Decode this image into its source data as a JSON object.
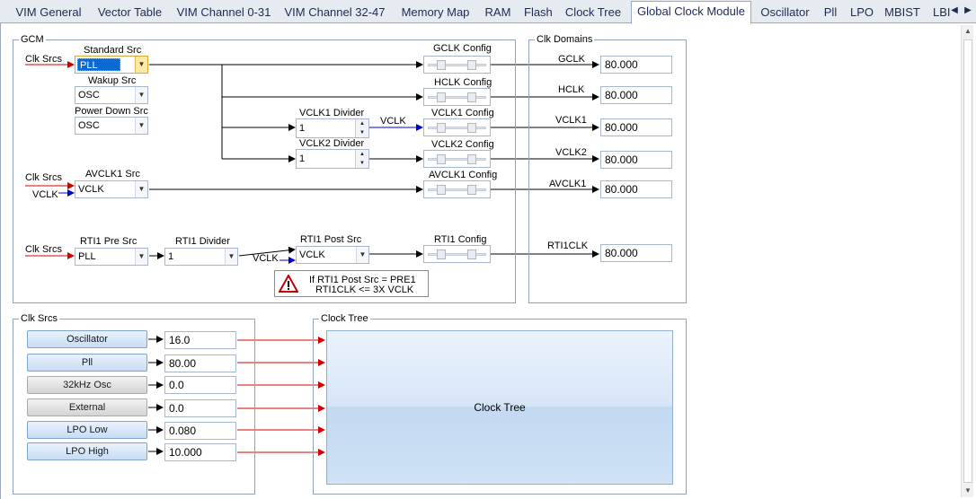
{
  "tabs": [
    {
      "label": "VIM General",
      "active": false
    },
    {
      "label": "Vector Table",
      "active": false
    },
    {
      "label": "VIM Channel 0-31",
      "active": false
    },
    {
      "label": "VIM Channel 32-47",
      "active": false
    },
    {
      "label": "Memory Map",
      "active": false
    },
    {
      "label": "RAM",
      "active": false
    },
    {
      "label": "Flash",
      "active": false
    },
    {
      "label": "Clock Tree",
      "active": false
    },
    {
      "label": "Global Clock Module",
      "active": true
    },
    {
      "label": "Oscillator",
      "active": false
    },
    {
      "label": "Pll",
      "active": false
    },
    {
      "label": "LPO",
      "active": false
    },
    {
      "label": "MBIST",
      "active": false
    },
    {
      "label": "LBI",
      "active": false
    }
  ],
  "gcm": {
    "title": "GCM",
    "clk_srcs_label": "Clk Srcs",
    "standard_src": {
      "label": "Standard Src",
      "value": "PLL"
    },
    "wakeup_src": {
      "label": "Wakup Src",
      "value": "OSC"
    },
    "power_down_src": {
      "label": "Power Down Src",
      "value": "OSC"
    },
    "vclk1_divider": {
      "label": "VCLK1 Divider",
      "value": "1"
    },
    "vclk2_divider": {
      "label": "VCLK2 Divider",
      "value": "1"
    },
    "vclk_signal": "VCLK",
    "gclk_config": "GCLK Config",
    "hclk_config": "HCLK Config",
    "vclk1_config": "VCLK1 Config",
    "vclk2_config": "VCLK2 Config",
    "avclk1_clk_srcs_label": "Clk Srcs",
    "avclk1_vclk_label": "VCLK",
    "avclk1_src": {
      "label": "AVCLK1 Src",
      "value": "VCLK"
    },
    "avclk1_config": "AVCLK1 Config",
    "rti_clk_srcs_label": "Clk Srcs",
    "rti1_pre_src": {
      "label": "RTI1 Pre Src",
      "value": "PLL"
    },
    "rti1_divider": {
      "label": "RTI1 Divider",
      "value": "1"
    },
    "rti1_post_src": {
      "label": "RTI1 Post Src",
      "value": "VCLK"
    },
    "rti_vclk_label": "VCLK",
    "rti1_config": "RTI1 Config",
    "warning_line1": "If RTI1 Post Src = PRE1",
    "warning_line2": "RTI1CLK <= 3X VCLK"
  },
  "clk_domains": {
    "title": "Clk Domains",
    "items": [
      {
        "label": "GCLK",
        "value": "80.000"
      },
      {
        "label": "HCLK",
        "value": "80.000"
      },
      {
        "label": "VCLK1",
        "value": "80.000"
      },
      {
        "label": "VCLK2",
        "value": "80.000"
      },
      {
        "label": "AVCLK1",
        "value": "80.000"
      },
      {
        "label": "RTI1CLK",
        "value": "80.000"
      }
    ]
  },
  "clk_srcs": {
    "title": "Clk Srcs",
    "items": [
      {
        "label": "Oscillator",
        "value": "16.0",
        "enabled": true
      },
      {
        "label": "Pll",
        "value": "80.00",
        "enabled": true
      },
      {
        "label": "32kHz Osc",
        "value": "0.0",
        "enabled": false
      },
      {
        "label": "External",
        "value": "0.0",
        "enabled": false
      },
      {
        "label": "LPO Low",
        "value": "0.080",
        "enabled": true
      },
      {
        "label": "LPO High",
        "value": "10.000",
        "enabled": true
      }
    ]
  },
  "clock_tree": {
    "title": "Clock Tree",
    "button_label": "Clock Tree"
  },
  "colors": {
    "wire_red": "#d40000",
    "wire_blue": "#0000cc",
    "wire_black": "#000000"
  }
}
